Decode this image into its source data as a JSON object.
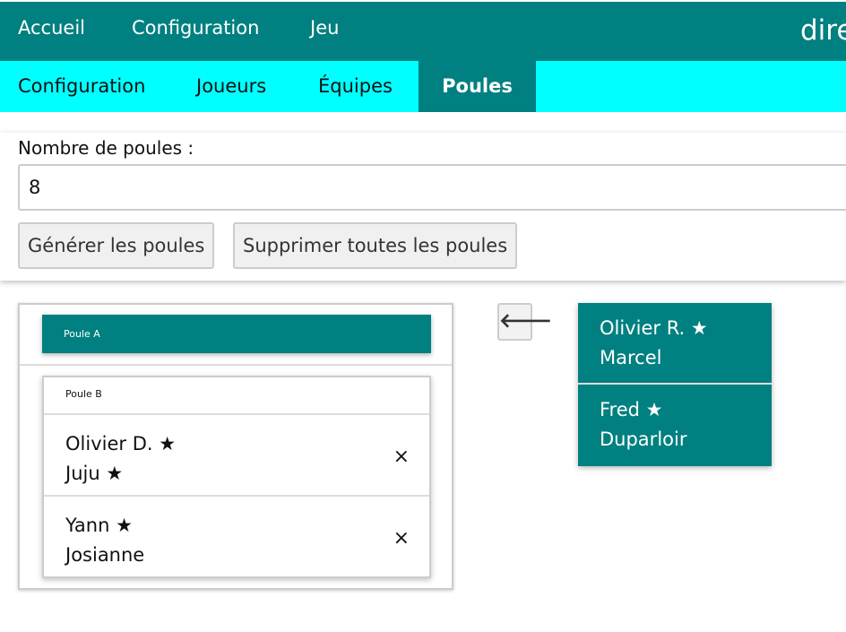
{
  "top_nav": {
    "items": [
      "Accueil",
      "Configuration",
      "Jeu"
    ],
    "brand": "dire"
  },
  "sub_nav": {
    "items": [
      "Configuration",
      "Joueurs",
      "Équipes",
      "Poules"
    ],
    "active": "Poules"
  },
  "form": {
    "label": "Nombre de poules :",
    "value": "8",
    "generate": "Générer les poules",
    "delete_all": "Supprimer toutes les poules"
  },
  "poules": [
    {
      "name": "Poule A",
      "teams": []
    },
    {
      "name": "Poule B",
      "teams": [
        {
          "player1": "Olivier D.",
          "player2": "Juju",
          "star1": true,
          "star2": true,
          "remove": "×"
        },
        {
          "player1": "Yann",
          "player2": "Josianne",
          "star1": true,
          "star2": false,
          "remove": "×"
        }
      ]
    }
  ],
  "back_arrow": "🡐",
  "star": "★",
  "unassigned": [
    {
      "player1": "Olivier R.",
      "player2": "Marcel"
    },
    {
      "player1": "Fred",
      "player2": "Duparloir"
    }
  ],
  "colors": {
    "primary": "#008080",
    "secondary": "#00ffff"
  }
}
